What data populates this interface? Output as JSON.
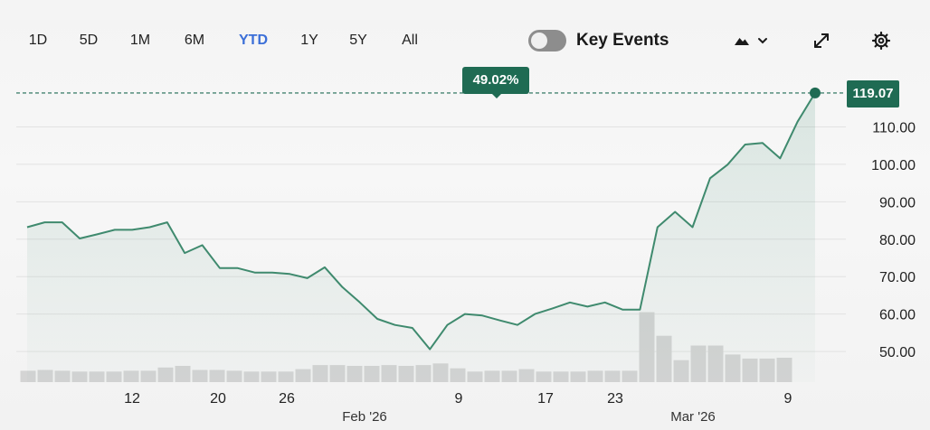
{
  "toolbar": {
    "ranges": [
      "1D",
      "5D",
      "1M",
      "6M",
      "YTD",
      "1Y",
      "5Y",
      "All"
    ],
    "active_range": "YTD",
    "key_events_label": "Key Events",
    "key_events_on": false
  },
  "icons": {
    "chart_type": "mountain-chart-icon",
    "chevron": "chevron-down-icon",
    "expand": "expand-icon",
    "settings": "gear-icon"
  },
  "colors": {
    "line": "#3f8a6e",
    "accent": "#1f6b53",
    "active_range": "#3b6fd8",
    "volume": "#d4d4d4"
  },
  "price_tag": "119.07",
  "change_tag": "49.02%",
  "chart_data": {
    "type": "area",
    "title": "",
    "xlabel": "",
    "ylabel": "",
    "ylim": [
      40,
      125
    ],
    "y_ticks": [
      "110.00",
      "100.00",
      "90.00",
      "80.00",
      "70.00",
      "60.00",
      "50.00"
    ],
    "x_tick_labels": [
      "12",
      "20",
      "26",
      "Feb '26",
      "9",
      "17",
      "23",
      "Mar '26",
      "9"
    ],
    "last_value": 119.07,
    "series": [
      {
        "values": [
          83.2,
          84.5,
          84.5,
          80.2,
          81.3,
          82.5,
          82.5,
          83.2,
          84.5,
          76.3,
          78.4,
          72.3,
          72.3,
          71.1,
          71.1,
          70.7,
          69.6,
          72.5,
          67.2,
          63.1,
          58.7,
          57.1,
          56.3,
          50.6,
          57.1,
          60.0,
          59.6,
          58.3,
          57.1,
          60.0,
          61.5,
          63.1,
          62.0,
          63.1,
          61.2,
          61.2,
          83.2,
          87.3,
          83.2,
          96.3,
          99.9,
          105.3,
          105.7,
          101.6,
          111.4,
          119.07
        ]
      }
    ],
    "volume": [
      14,
      15,
      14,
      13,
      13,
      13,
      14,
      14,
      18,
      20,
      15,
      15,
      14,
      13,
      13,
      13,
      16,
      21,
      21,
      20,
      20,
      21,
      20,
      21,
      23,
      17,
      13,
      14,
      14,
      16,
      13,
      13,
      13,
      14,
      14,
      14,
      86,
      57,
      27,
      45,
      45,
      34,
      29,
      29,
      30
    ]
  }
}
